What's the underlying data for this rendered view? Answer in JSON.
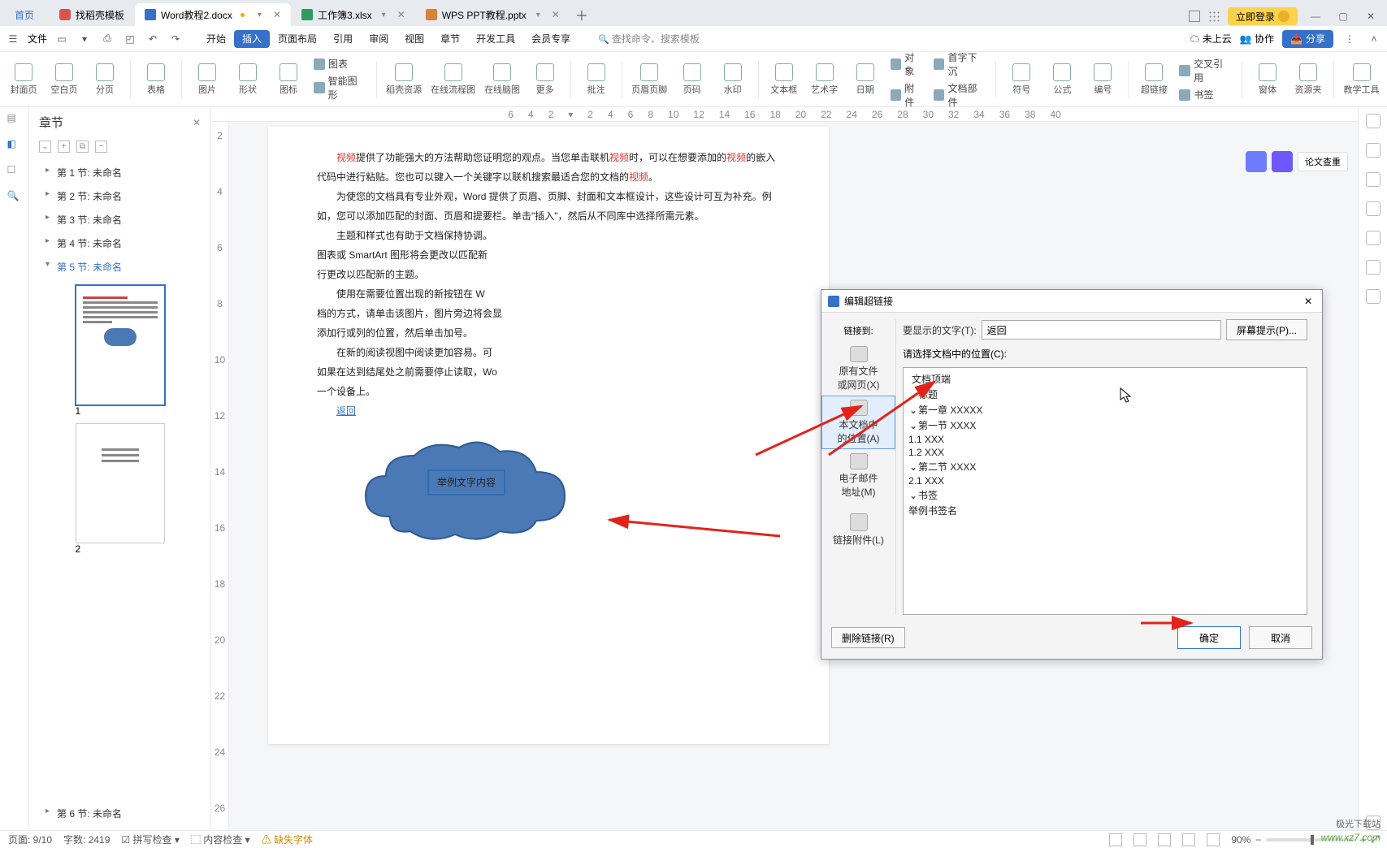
{
  "tabs": {
    "home": "首页",
    "template": "找稻壳模板",
    "doc": "Word教程2.docx",
    "excel": "工作簿3.xlsx",
    "ppt": "WPS PPT教程.pptx"
  },
  "login": "立即登录",
  "menubar": {
    "file": "文件",
    "items": [
      "开始",
      "插入",
      "页面布局",
      "引用",
      "审阅",
      "视图",
      "章节",
      "开发工具",
      "会员专享"
    ],
    "search": "查找命令、搜索模板",
    "cloud": "未上云",
    "collab": "协作",
    "share": "分享"
  },
  "ribbon": {
    "items": [
      "封面页",
      "空白页",
      "分页",
      "表格",
      "图片",
      "形状",
      "图标",
      "智能图形",
      "稻壳资源",
      "在线流程图",
      "在线脑图",
      "更多",
      "批注",
      "页眉页脚",
      "页码",
      "水印",
      "文本框",
      "艺术字",
      "日期",
      "附件",
      "文档部件",
      "符号",
      "公式",
      "编号",
      "超链接",
      "书签",
      "窗体",
      "资源夹",
      "教学工具"
    ],
    "extra1": "图表",
    "extra2": "对象",
    "extra3": "首字下沉",
    "extra4": "交叉引用"
  },
  "sidebar": {
    "title": "章节",
    "sections": [
      "第 1 节: 未命名",
      "第 2 节: 未命名",
      "第 3 节: 未命名",
      "第 4 节: 未命名",
      "第 5 节: 未命名",
      "第 6 节: 未命名"
    ],
    "thumb1": "1",
    "thumb2": "2"
  },
  "doc": {
    "p1a": "视频",
    "p1b": "提供了功能强大的方法帮助您证明您的观点。当您单击联机",
    "p1c": "视频",
    "p1d": "时，可以在想要添加的",
    "p1e": "视频",
    "p1f": "的嵌入代码中进行粘贴。您也可以键入一个关键字以联机搜索最适合您的文档的",
    "p1g": "视频",
    "p1h": "。",
    "p2": "为使您的文档具有专业外观，Word 提供了页眉、页脚、封面和文本框设计，这些设计可互为补充。例如，您可以添加匹配的封面、页眉和提要栏。单击\"插入\"，然后从不同库中选择所需元素。",
    "p3": "主题和样式也有助于文档保持协调。",
    "p4": "图表或 SmartArt 图形将会更改以匹配新",
    "p5": "行更改以匹配新的主题。",
    "p6": "使用在需要位置出现的新按钮在 W",
    "p7": "档的方式，请单击该图片，图片旁边将会显",
    "p8": "添加行或列的位置，然后单击加号。",
    "p9": "在新的阅读视图中阅读更加容易。可",
    "p10": "如果在达到结尾处之前需要停止读取，Wo",
    "p11": "一个设备上。",
    "link": "返回",
    "cloud": "举例文字内容"
  },
  "dialog": {
    "title": "编辑超链接",
    "linkto": "链接到:",
    "disptext": "要显示的文字(T):",
    "dispval": "返回",
    "screentip": "屏幕提示(P)...",
    "select": "请选择文档中的位置(C):",
    "left": {
      "a": "原有文件\n或网页(X)",
      "b": "本文档中\n的位置(A)",
      "c": "电子邮件\n地址(M)",
      "d": "链接附件(L)"
    },
    "tree": {
      "top": "文档顶端",
      "heading": "标题",
      "ch1": "第一章 XXXXX",
      "s1": "第一节 XXXX",
      "n11": "1.1 XXX",
      "n12": "1.2 XXX",
      "s2": "第二节 XXXX",
      "n21": "2.1 XXX",
      "bookmark": "书签",
      "bk1": "举例书签名"
    },
    "remove": "删除链接(R)",
    "ok": "确定",
    "cancel": "取消"
  },
  "float": {
    "a": "论文查重"
  },
  "status": {
    "page": "页面: 9/10",
    "words": "字数: 2419",
    "spell": "拼写检查",
    "content": "内容检查",
    "font": "缺失字体",
    "zoom": "90%"
  },
  "watermark": {
    "a": "极光下载站",
    "b": "www.xz7.com"
  }
}
